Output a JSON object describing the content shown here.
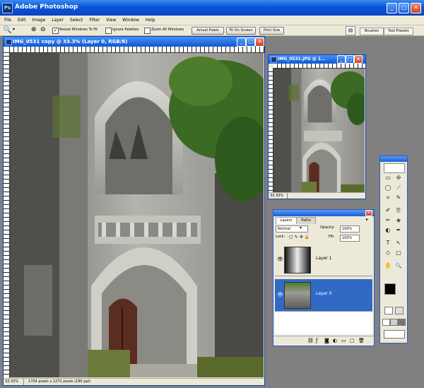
{
  "app": {
    "title": "Adobe Photoshop",
    "logo": "Ps"
  },
  "window_controls": {
    "minimize": "_",
    "maximize": "□",
    "close": "✕"
  },
  "menu": [
    "File",
    "Edit",
    "Image",
    "Layer",
    "Select",
    "Filter",
    "View",
    "Window",
    "Help"
  ],
  "options": {
    "zoom_in": "⊕",
    "zoom_out": "⊖",
    "checks": [
      {
        "label": "Resize Windows To Fit",
        "checked": true
      },
      {
        "label": "Ignore Palettes",
        "checked": false
      },
      {
        "label": "Zoom All Windows",
        "checked": false
      }
    ],
    "buttons": [
      "Actual Pixels",
      "Fit On Screen",
      "Print Size"
    ],
    "right_tabs": [
      "Brushes",
      "Tool Presets"
    ]
  },
  "doc_main": {
    "title": "IMG_0531 copy @ 33.3% (Layer 0, RGB/8)",
    "zoom": "33.33%",
    "status": "1704 pixels x 2272 pixels (180 ppi)"
  },
  "doc_small": {
    "title": "IMG_0531.JPG @ 1...",
    "zoom": "33.33%"
  },
  "layers_palette": {
    "tabs": [
      "Layers",
      "Paths"
    ],
    "blend_mode": "Normal",
    "opacity_label": "Opacity:",
    "opacity_value": "100%",
    "lock_label": "Lock:",
    "fill_label": "Fill:",
    "fill_value": "100%",
    "layers": [
      {
        "name": "Layer 1",
        "visible": true,
        "selected": false
      },
      {
        "name": "Layer 0",
        "visible": true,
        "selected": true
      }
    ],
    "footer_icons": [
      "link-icon",
      "fx-icon",
      "mask-icon",
      "adjustment-icon",
      "folder-icon",
      "new-layer-icon",
      "trash-icon"
    ]
  },
  "toolbox": {
    "tools": [
      "▭",
      "✣",
      "◯",
      "⟋",
      "⌗",
      "✎",
      "✐",
      "⎘",
      "✂",
      "◈",
      "◐",
      "✒",
      "T",
      "↖",
      "◇",
      "▢",
      "✋",
      "🔍"
    ]
  },
  "colors": {
    "titlebar": "#0a56d8",
    "selected_layer": "#316ac5",
    "workspace": "#808080"
  }
}
